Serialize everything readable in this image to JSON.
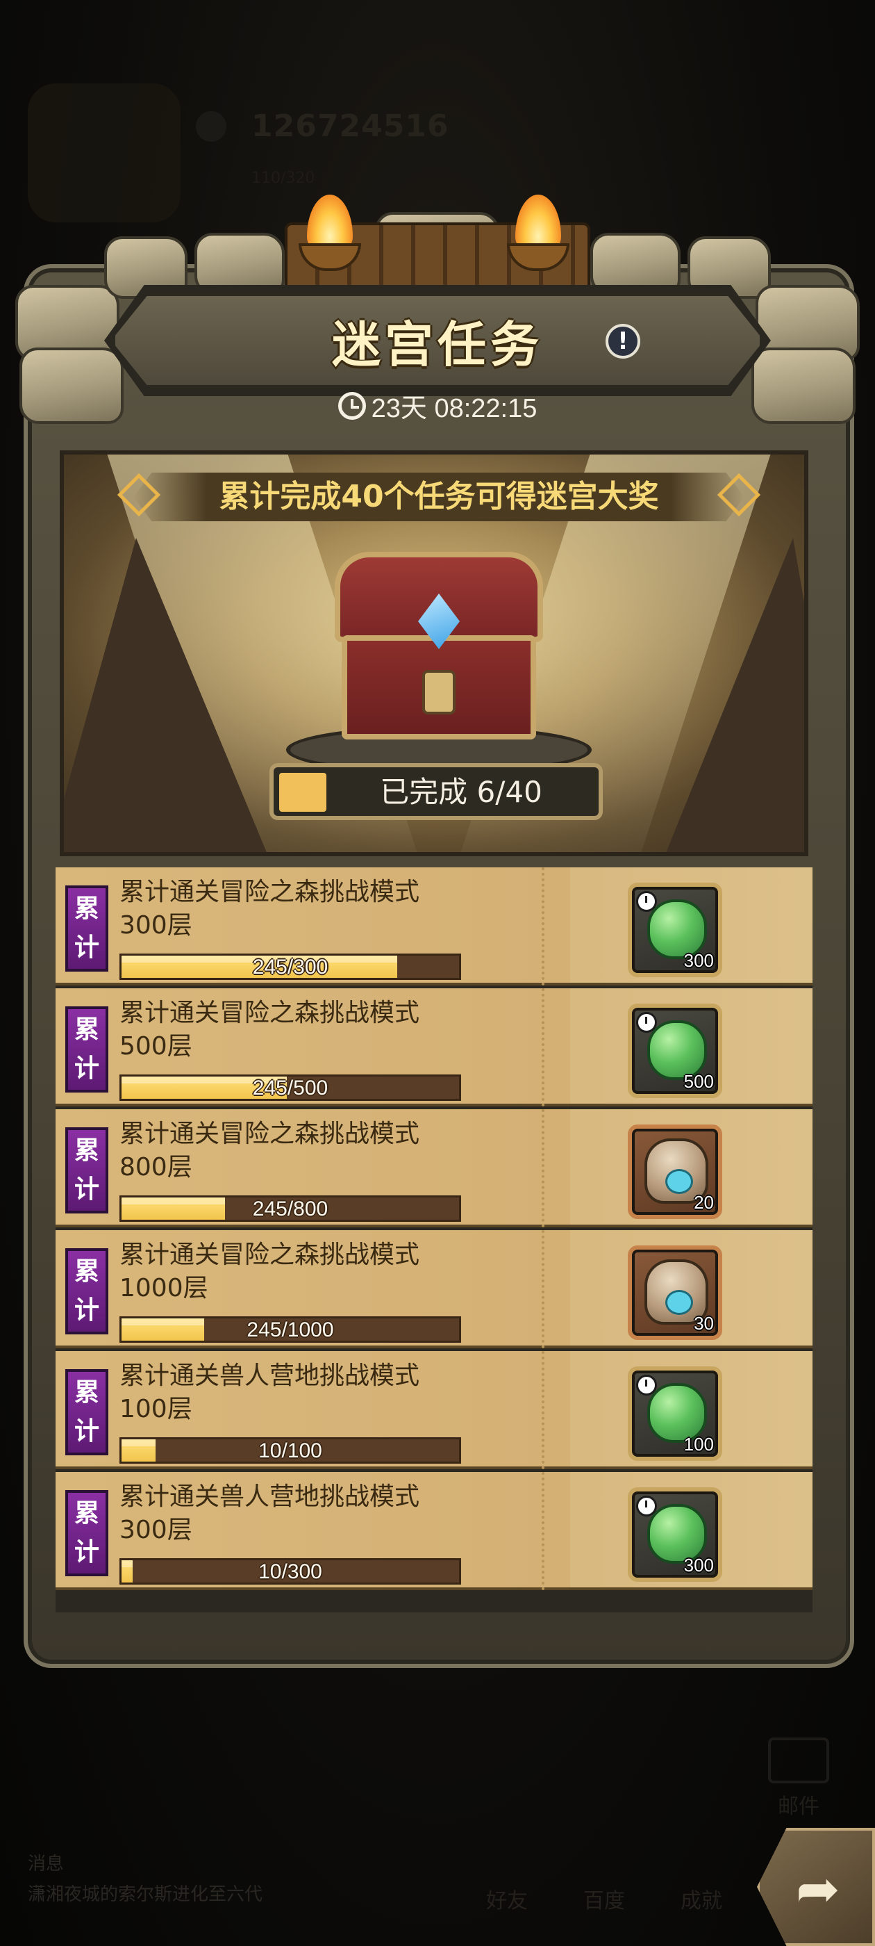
{
  "background": {
    "player_id": "126724516",
    "player_sub": "110/320",
    "mail_label": "邮件",
    "news_line_1": "消息",
    "news_line_2": "潇湘夜城的索尔斯进化至六代",
    "tabs": [
      "好友",
      "百度",
      "成就"
    ]
  },
  "dialog": {
    "title": "迷宫任务",
    "info_icon": "!",
    "timer": "23天 08:22:15"
  },
  "showcase": {
    "banner_text": "累计完成40个任务可得迷宫大奖",
    "progress_text": "已完成 6/40",
    "completed": 6,
    "total": 40
  },
  "quests": [
    {
      "tag": "累计",
      "title": "累计通关冒险之森挑战模式\n300层",
      "current": 245,
      "target": 300,
      "progress_text": "245/300",
      "reward_type": "green",
      "reward_icon": "green-seed-icon",
      "reward_qty": "300"
    },
    {
      "tag": "累计",
      "title": "累计通关冒险之森挑战模式\n500层",
      "current": 245,
      "target": 500,
      "progress_text": "245/500",
      "reward_type": "green",
      "reward_icon": "green-seed-icon",
      "reward_qty": "500"
    },
    {
      "tag": "累计",
      "title": "累计通关冒险之森挑战模式\n800层",
      "current": 245,
      "target": 800,
      "progress_text": "245/800",
      "reward_type": "bronze",
      "reward_icon": "pet-bag-icon",
      "reward_qty": "20"
    },
    {
      "tag": "累计",
      "title": "累计通关冒险之森挑战模式\n1000层",
      "current": 245,
      "target": 1000,
      "progress_text": "245/1000",
      "reward_type": "bronze",
      "reward_icon": "pet-bag-icon",
      "reward_qty": "30"
    },
    {
      "tag": "累计",
      "title": "累计通关兽人营地挑战模式\n100层",
      "current": 10,
      "target": 100,
      "progress_text": "10/100",
      "reward_type": "green",
      "reward_icon": "green-seed-icon",
      "reward_qty": "100"
    },
    {
      "tag": "累计",
      "title": "累计通关兽人营地挑战模式\n300层",
      "current": 10,
      "target": 300,
      "progress_text": "10/300",
      "reward_type": "green",
      "reward_icon": "green-seed-icon",
      "reward_qty": "300"
    }
  ],
  "colors": {
    "accent_gold": "#f2c05a",
    "tag_purple": "#8a2fa3",
    "parchment": "#d9b77b"
  }
}
